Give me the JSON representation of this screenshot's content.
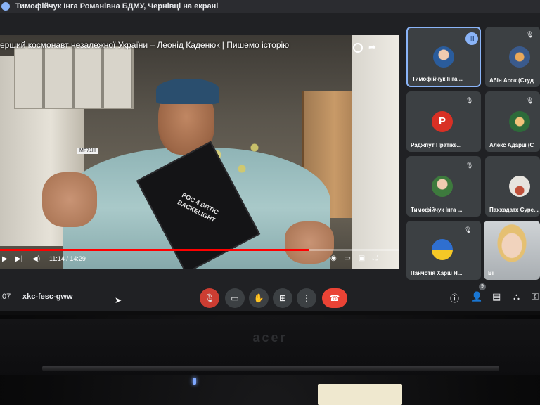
{
  "share_banner": "Тимофійчук Інга Романівна БДМУ, Чернівці на екрані",
  "video": {
    "title": "ерший космонавт незалежної України – Леонід Каденюк | Пишемо історію",
    "current_time": "11:14",
    "duration": "14:29",
    "time_display": "11:14 / 14:29",
    "progress": 0.775,
    "tag_text": "MF71H",
    "box_text": "PGC 4 BRTIC BACKELIGHT"
  },
  "participants": [
    {
      "name": "Тимофійчук Інга ...",
      "active": true,
      "speaking": true,
      "avatar": "photo-avatar"
    },
    {
      "name": "Абін Асок (Студ",
      "active": false,
      "muted": true,
      "avatar": "photo-avatar"
    },
    {
      "name": "Раджпут Пратіке...",
      "active": false,
      "muted": true,
      "avatar": "letter",
      "letter": "P",
      "color": "#d93025"
    },
    {
      "name": "Алекс Адарш (С",
      "active": false,
      "muted": true,
      "avatar": "photo-avatar"
    },
    {
      "name": "Тимофійчук Інга ...",
      "active": false,
      "muted": true,
      "avatar": "photo-avatar"
    },
    {
      "name": "Паххадатх Суре...",
      "active": false,
      "muted": false,
      "avatar": "photo-avatar"
    },
    {
      "name": "Панчотія Харш Н...",
      "active": false,
      "muted": true,
      "avatar": "flag-avatar"
    },
    {
      "name": "Ві",
      "active": false,
      "muted": false,
      "avatar": "video"
    }
  ],
  "bottombar": {
    "time": ":07",
    "separator": "|",
    "meeting_code": "xkc-fesc-gww",
    "people_count": "9"
  },
  "laptop": {
    "brand": "acer"
  },
  "colors": {
    "meet_bg": "#202124",
    "tile_bg": "#3c4043",
    "accent": "#8ab4f8",
    "danger": "#ea4335"
  }
}
